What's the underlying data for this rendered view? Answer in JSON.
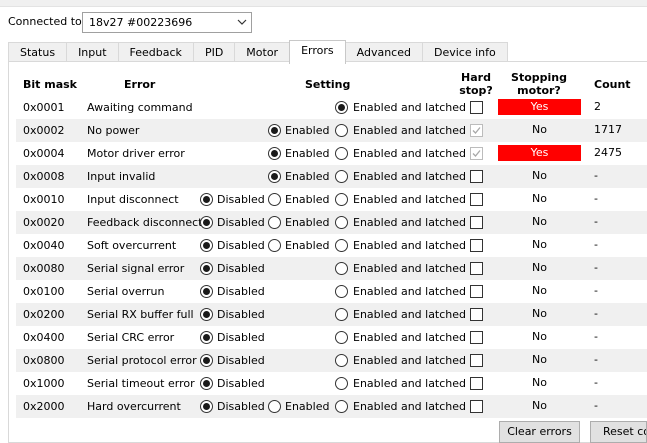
{
  "connection": {
    "label": "Connected to:",
    "device": "18v27 #00223696"
  },
  "tabs": [
    {
      "label": "Status",
      "active": false
    },
    {
      "label": "Input",
      "active": false
    },
    {
      "label": "Feedback",
      "active": false
    },
    {
      "label": "PID",
      "active": false
    },
    {
      "label": "Motor",
      "active": false
    },
    {
      "label": "Errors",
      "active": true
    },
    {
      "label": "Advanced",
      "active": false
    },
    {
      "label": "Device info",
      "active": false
    }
  ],
  "headers": {
    "bitmask": "Bit mask",
    "error": "Error",
    "setting": "Setting",
    "hard_stop_line1": "Hard",
    "hard_stop_line2": "stop?",
    "stopping_line1": "Stopping",
    "stopping_line2": "motor?",
    "count": "Count"
  },
  "labels": {
    "disabled": "Disabled",
    "enabled": "Enabled",
    "enabled_latched": "Enabled and latched"
  },
  "errors": [
    {
      "mask": "0x0001",
      "name": "Awaiting command",
      "options": [
        "enabled_latched"
      ],
      "selected": "enabled_latched",
      "hard_stop": false,
      "stopping": "Yes",
      "count": "2"
    },
    {
      "mask": "0x0002",
      "name": "No power",
      "options": [
        "enabled",
        "enabled_latched"
      ],
      "selected": "enabled",
      "hard_stop": true,
      "stopping": "No",
      "count": "1717"
    },
    {
      "mask": "0x0004",
      "name": "Motor driver error",
      "options": [
        "enabled",
        "enabled_latched"
      ],
      "selected": "enabled",
      "hard_stop": true,
      "stopping": "Yes",
      "count": "2475"
    },
    {
      "mask": "0x0008",
      "name": "Input invalid",
      "options": [
        "enabled",
        "enabled_latched"
      ],
      "selected": "enabled",
      "hard_stop": false,
      "stopping": "No",
      "count": "-"
    },
    {
      "mask": "0x0010",
      "name": "Input disconnect",
      "options": [
        "disabled",
        "enabled",
        "enabled_latched"
      ],
      "selected": "disabled",
      "hard_stop": false,
      "stopping": "No",
      "count": "-"
    },
    {
      "mask": "0x0020",
      "name": "Feedback disconnect",
      "options": [
        "disabled",
        "enabled",
        "enabled_latched"
      ],
      "selected": "disabled",
      "hard_stop": false,
      "stopping": "No",
      "count": "-"
    },
    {
      "mask": "0x0040",
      "name": "Soft overcurrent",
      "options": [
        "disabled",
        "enabled",
        "enabled_latched"
      ],
      "selected": "disabled",
      "hard_stop": false,
      "stopping": "No",
      "count": "-"
    },
    {
      "mask": "0x0080",
      "name": "Serial signal error",
      "options": [
        "disabled",
        "enabled_latched"
      ],
      "selected": "disabled",
      "hard_stop": false,
      "stopping": "No",
      "count": "-"
    },
    {
      "mask": "0x0100",
      "name": "Serial overrun",
      "options": [
        "disabled",
        "enabled_latched"
      ],
      "selected": "disabled",
      "hard_stop": false,
      "stopping": "No",
      "count": "-"
    },
    {
      "mask": "0x0200",
      "name": "Serial RX buffer full",
      "options": [
        "disabled",
        "enabled_latched"
      ],
      "selected": "disabled",
      "hard_stop": false,
      "stopping": "No",
      "count": "-"
    },
    {
      "mask": "0x0400",
      "name": "Serial CRC error",
      "options": [
        "disabled",
        "enabled_latched"
      ],
      "selected": "disabled",
      "hard_stop": false,
      "stopping": "No",
      "count": "-"
    },
    {
      "mask": "0x0800",
      "name": "Serial protocol error",
      "options": [
        "disabled",
        "enabled_latched"
      ],
      "selected": "disabled",
      "hard_stop": false,
      "stopping": "No",
      "count": "-"
    },
    {
      "mask": "0x1000",
      "name": "Serial timeout error",
      "options": [
        "disabled",
        "enabled_latched"
      ],
      "selected": "disabled",
      "hard_stop": false,
      "stopping": "No",
      "count": "-"
    },
    {
      "mask": "0x2000",
      "name": "Hard overcurrent",
      "options": [
        "disabled",
        "enabled",
        "enabled_latched"
      ],
      "selected": "disabled",
      "hard_stop": false,
      "stopping": "No",
      "count": "-"
    }
  ],
  "buttons": {
    "clear_errors": "Clear errors",
    "reset_counts": "Reset counts"
  },
  "colors": {
    "stopping_yes_bg": "#ff0000",
    "row_shade": "#f0f0f0"
  }
}
